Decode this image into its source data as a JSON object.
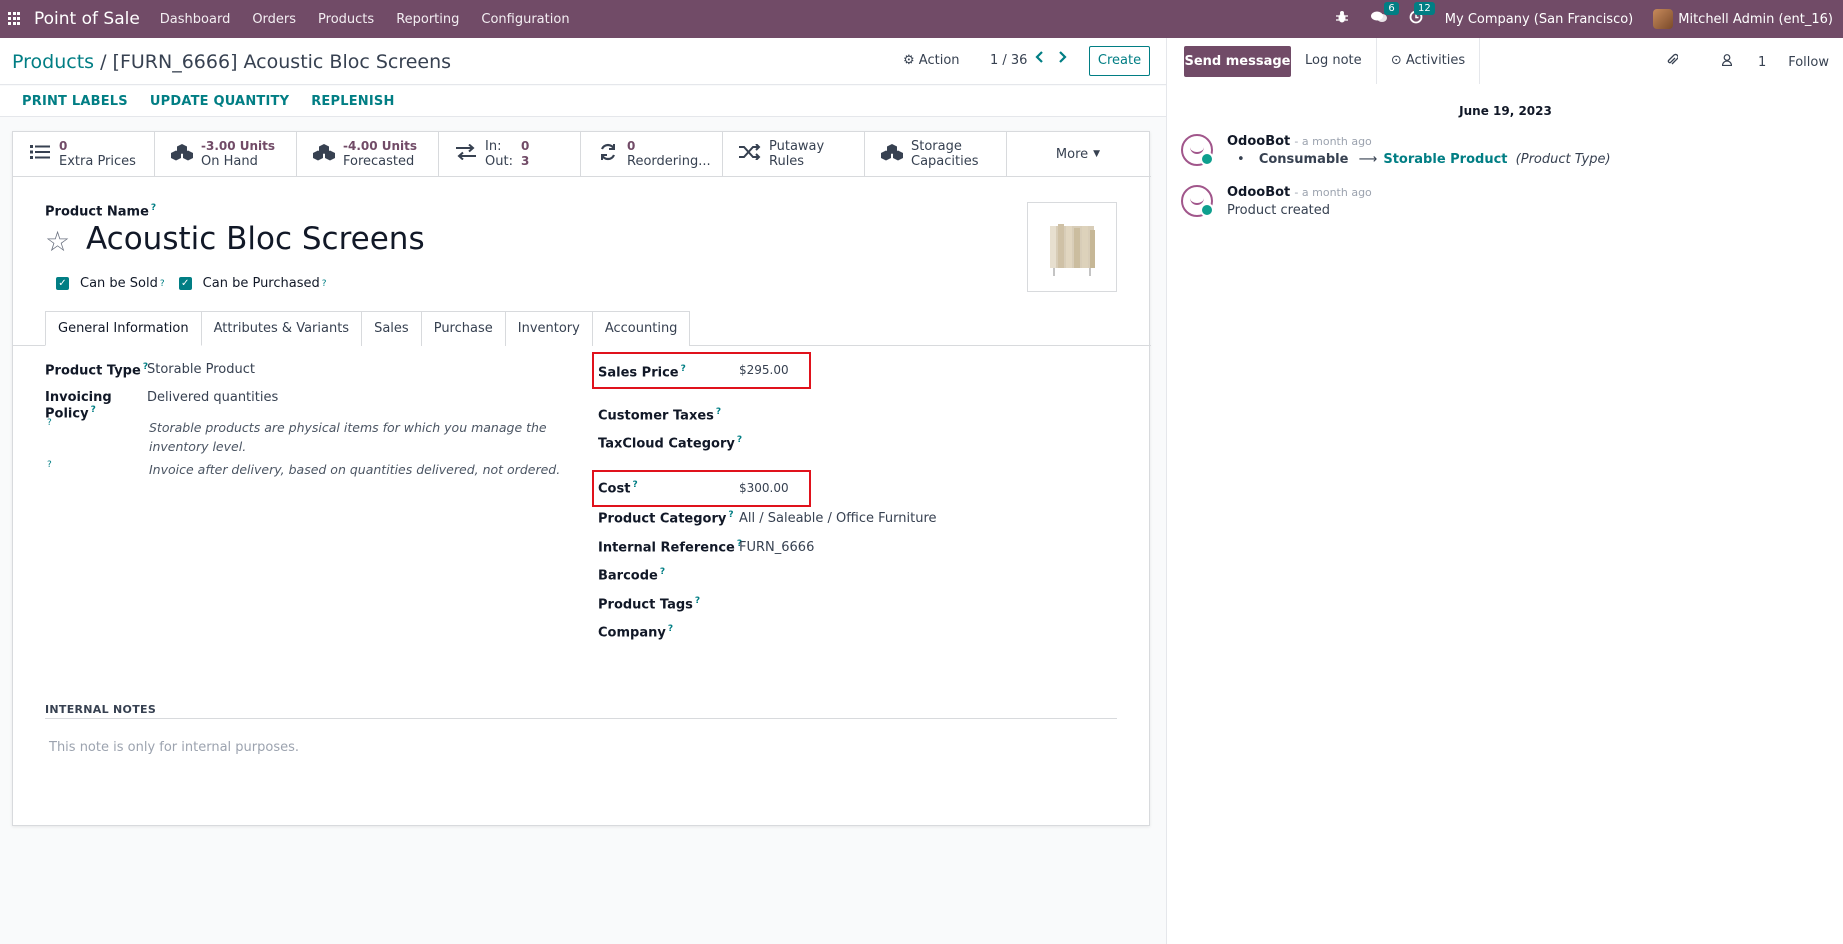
{
  "navbar": {
    "brand": "Point of Sale",
    "menu": [
      "Dashboard",
      "Orders",
      "Products",
      "Reporting",
      "Configuration"
    ],
    "messages_count": "6",
    "activities_count": "12",
    "company": "My Company (San Francisco)",
    "user": "Mitchell Admin (ent_16)"
  },
  "control": {
    "breadcrumb_root": "Products",
    "breadcrumb_sep": "/",
    "breadcrumb_current": "[FURN_6666] Acoustic Bloc Screens",
    "action_label": "Action",
    "pager": "1 / 36",
    "create_label": "Create"
  },
  "status_buttons": [
    "PRINT LABELS",
    "UPDATE QUANTITY",
    "REPLENISH"
  ],
  "smart_buttons": {
    "extra_prices": {
      "value": "0",
      "label": "Extra Prices"
    },
    "on_hand": {
      "value": "-3.00 Units",
      "label": "On Hand"
    },
    "forecasted": {
      "value": "-4.00 Units",
      "label": "Forecasted"
    },
    "in_out": {
      "in_label": "In:",
      "in_value": "0",
      "out_label": "Out:",
      "out_value": "3"
    },
    "reordering": {
      "value": "0",
      "label": "Reordering..."
    },
    "putaway": {
      "line1": "Putaway",
      "line2": "Rules"
    },
    "storage": {
      "line1": "Storage",
      "line2": "Capacities"
    },
    "more": "More"
  },
  "product": {
    "name_label": "Product Name",
    "name": "Acoustic Bloc Screens",
    "can_be_sold": "Can be Sold",
    "can_be_purchased": "Can be Purchased"
  },
  "tabs": [
    "General Information",
    "Attributes & Variants",
    "Sales",
    "Purchase",
    "Inventory",
    "Accounting"
  ],
  "general": {
    "product_type_label": "Product Type",
    "product_type": "Storable Product",
    "invoicing_policy_label": "Invoicing Policy",
    "invoicing_policy": "Delivered quantities",
    "type_help_1": "Storable products are physical items for which you manage the",
    "type_help_2": "inventory level.",
    "invoice_help": "Invoice after delivery, based on quantities delivered, not ordered.",
    "sales_price_label": "Sales Price",
    "sales_price": "$295.00",
    "customer_taxes_label": "Customer Taxes",
    "taxcloud_label": "TaxCloud Category",
    "cost_label": "Cost",
    "cost": "$300.00",
    "category_label": "Product Category",
    "category": "All / Saleable / Office Furniture",
    "internal_ref_label": "Internal Reference",
    "internal_ref": "FURN_6666",
    "barcode_label": "Barcode",
    "tags_label": "Product Tags",
    "company_label": "Company"
  },
  "notes": {
    "label": "INTERNAL NOTES",
    "placeholder": "This note is only for internal purposes."
  },
  "chatter": {
    "send_message": "Send message",
    "log_note": "Log note",
    "activities": "Activities",
    "followers_count": "1",
    "follow": "Follow",
    "date": "June 19, 2023",
    "messages": [
      {
        "author": "OdooBot",
        "time": "- a month ago",
        "old": "Consumable",
        "new": "Storable Product",
        "field": "(Product Type)"
      },
      {
        "author": "OdooBot",
        "time": "- a month ago",
        "text": "Product created"
      }
    ]
  },
  "colors": {
    "brand": "#714b67",
    "accent": "#017e84",
    "highlight": "#e0121c"
  }
}
